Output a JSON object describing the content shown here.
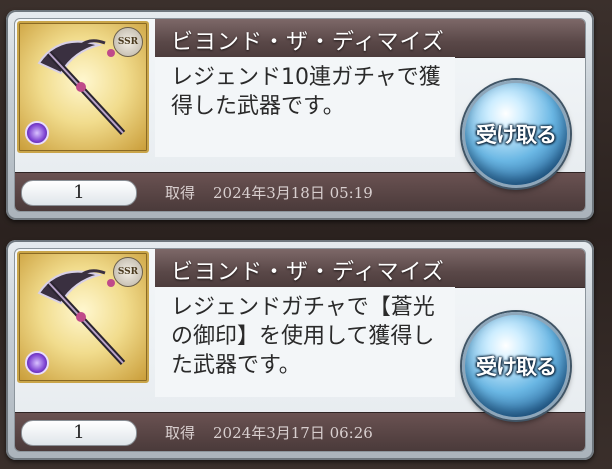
{
  "rewards": [
    {
      "title": "ビヨンド・ザ・ディマイズ",
      "rarity": "SSR",
      "description": "レジェンド10連ガチャで獲得した武器です。",
      "quantity": "1",
      "acquired_label": "取得",
      "acquired_date": "2024年3月18日 05:19",
      "receive_label": "受け取る",
      "thumbnail_icon": "scythe-weapon-icon",
      "element_icon": "dark-element-icon"
    },
    {
      "title": "ビヨンド・ザ・ディマイズ",
      "rarity": "SSR",
      "description": "レジェンドガチャで【蒼光の御印】を使用して獲得した武器です。",
      "quantity": "1",
      "acquired_label": "取得",
      "acquired_date": "2024年3月17日 06:26",
      "receive_label": "受け取る",
      "thumbnail_icon": "scythe-weapon-icon",
      "element_icon": "dark-element-icon"
    }
  ],
  "colors": {
    "title_bar": "#5a4848",
    "receive_button": "#6ab7e4",
    "thumbnail_frame": "#c9a54a"
  }
}
